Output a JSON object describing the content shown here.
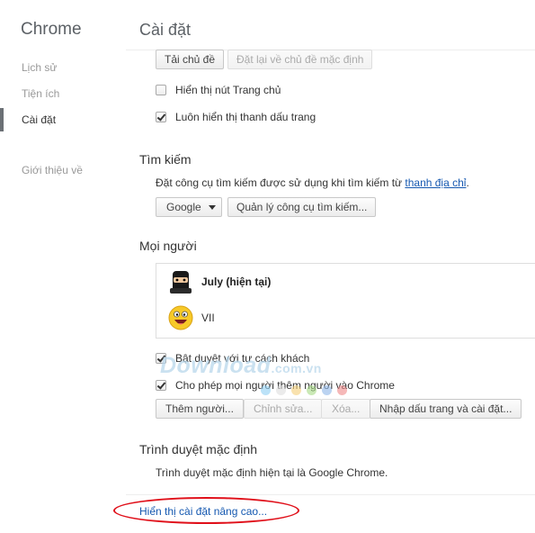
{
  "sidebar": {
    "brand": "Chrome",
    "items": [
      {
        "label": "Lịch sử"
      },
      {
        "label": "Tiện ích"
      },
      {
        "label": "Cài đặt"
      },
      {
        "label": "Giới thiệu về"
      }
    ]
  },
  "header": {
    "title": "Cài đặt"
  },
  "appearance": {
    "get_themes": "Tải chủ đề",
    "reset_theme": "Đặt lại về chủ đề mặc định",
    "show_home": "Hiển thị nút Trang chủ",
    "show_home_checked": false,
    "show_bookmarks": "Luôn hiển thị thanh dấu trang",
    "show_bookmarks_checked": true
  },
  "search": {
    "title": "Tìm kiếm",
    "desc_prefix": "Đặt công cụ tìm kiếm được sử dụng khi tìm kiếm từ ",
    "desc_link": "thanh địa chỉ",
    "desc_suffix": ".",
    "engine_value": "Google",
    "manage_label": "Quản lý công cụ tìm kiếm..."
  },
  "people": {
    "title": "Mọi người",
    "profiles": [
      {
        "name": "July (hiện tại)",
        "avatar": "ninja-avatar"
      },
      {
        "name": "VII",
        "avatar": "smiley-avatar"
      }
    ],
    "guest": "Bật duyệt với tư cách khách",
    "guest_checked": true,
    "allow_add": "Cho phép mọi người thêm người vào Chrome",
    "allow_add_checked": true,
    "add_person": "Thêm người...",
    "edit": "Chỉnh sửa...",
    "remove": "Xóa...",
    "import": "Nhập dấu trang và cài đặt..."
  },
  "default_browser": {
    "title": "Trình duyệt mặc định",
    "desc": "Trình duyệt mặc định hiện tại là Google Chrome."
  },
  "advanced_link": "Hiển thị cài đặt nâng cao...",
  "watermark": {
    "text": "Download",
    "suffix": ".com.vn"
  },
  "colors": {
    "accent_link": "#1558b0",
    "highlight": "#e0101a"
  }
}
